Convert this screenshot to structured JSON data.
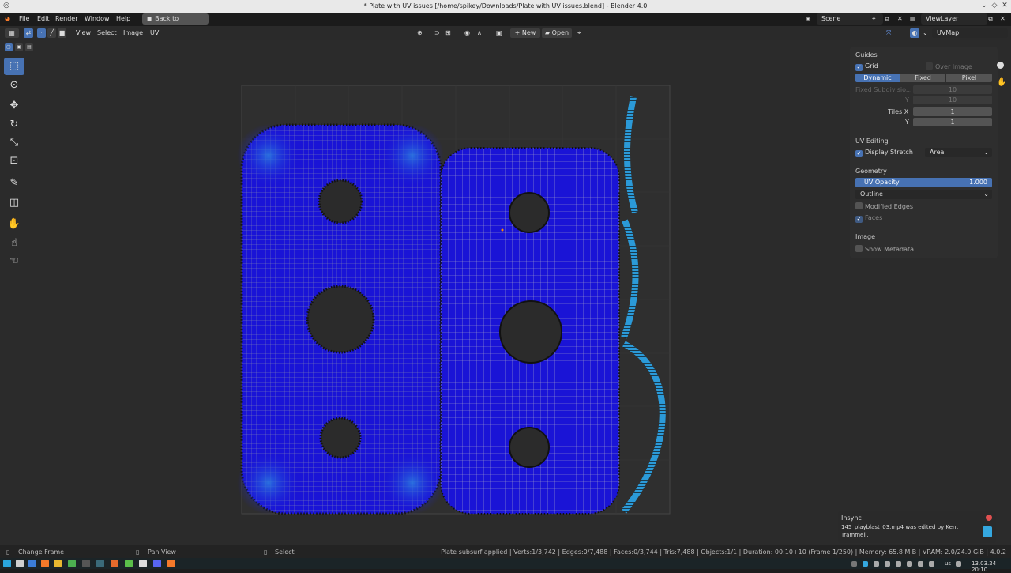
{
  "window": {
    "title": "* Plate with UV issues [/home/spikey/Downloads/Plate with UV issues.blend] - Blender 4.0"
  },
  "menubar": {
    "items": [
      "File",
      "Edit",
      "Render",
      "Window",
      "Help"
    ],
    "back_button": "Back to Previous",
    "scene_label": "Scene",
    "viewlayer_label": "ViewLayer"
  },
  "editor_header": {
    "menus": [
      "View",
      "Select",
      "Image",
      "UV"
    ],
    "new_label": "New",
    "open_label": "Open",
    "uvmap_name": "UVMap"
  },
  "sidebar_panel": {
    "guides_heading": "Guides",
    "grid_label": "Grid",
    "grid_checked": true,
    "over_image_label": "Over Image",
    "grid_modes": [
      "Dynamic",
      "Fixed",
      "Pixel"
    ],
    "grid_mode_selected": "Dynamic",
    "fixed_subdivisions_label": "Fixed Subdivisio...",
    "fixed_x": "10",
    "fixed_y_label": "Y",
    "fixed_y": "10",
    "tiles_x_label": "Tiles X",
    "tiles_x": "1",
    "tiles_y_label": "Y",
    "tiles_y": "1",
    "uv_editing_heading": "UV Editing",
    "display_stretch_label": "Display Stretch",
    "display_stretch_checked": true,
    "stretch_mode": "Area",
    "geometry_heading": "Geometry",
    "uv_opacity_label": "UV Opacity",
    "uv_opacity_value": "1.000",
    "edge_display": "Outline",
    "modified_edges_label": "Modified Edges",
    "faces_label": "Faces",
    "image_heading": "Image",
    "show_metadata_label": "Show Metadata"
  },
  "notification": {
    "app": "Insync",
    "message": "145_playblast_03.mp4 was edited by Kent Trammell."
  },
  "statusbar": {
    "change_frame": "Change Frame",
    "pan_view": "Pan View",
    "select": "Select",
    "stats": "Plate subsurf applied | Verts:1/3,742 | Edges:0/7,488 | Faces:0/3,744 | Tris:7,488 | Objects:1/1 | Duration: 00:10+10 (Frame 1/250) | Memory: 65.8 MiB | VRAM: 2.0/24.0 GiB | 4.0.2"
  },
  "taskbar": {
    "keyboard_layout": "us",
    "clock": "13.03.24 20:10"
  },
  "colors": {
    "accent": "#4772b3",
    "uv_fill": "#1a14d6",
    "uv_fill_light": "#2b79e0",
    "uv_edges": "#c0c0c0"
  }
}
